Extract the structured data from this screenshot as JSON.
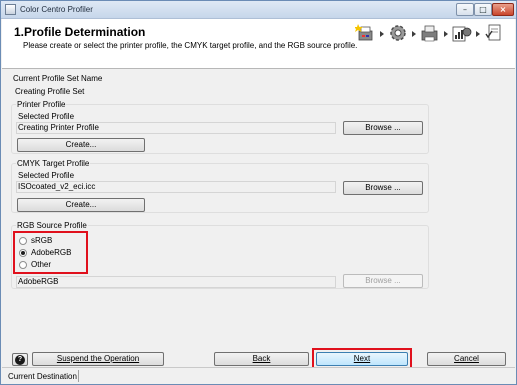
{
  "window": {
    "title": "Color Centro Profiler"
  },
  "header": {
    "title": "1.Profile Determination",
    "subtitle": "Please create or select the printer profile, the CMYK target profile, and the RGB source profile.",
    "steps": [
      "printer-wand-icon",
      "gear-icon",
      "printer-plus-icon",
      "chart-icon",
      "document-check-icon"
    ]
  },
  "profile_set": {
    "heading": "Current Profile Set Name",
    "value": "Creating Profile Set"
  },
  "printer_profile": {
    "group_title": "Printer Profile",
    "selected_label": "Selected Profile",
    "selected_value": "Creating Printer Profile",
    "browse_label": "Browse ...",
    "create_label": "Create..."
  },
  "cmyk_profile": {
    "group_title": "CMYK Target Profile",
    "selected_label": "Selected Profile",
    "selected_value": "ISOcoated_v2_eci.icc",
    "browse_label": "Browse ...",
    "create_label": "Create..."
  },
  "rgb_profile": {
    "group_title": "RGB Source Profile",
    "options": [
      {
        "label": "sRGB",
        "checked": false
      },
      {
        "label": "AdobeRGB",
        "checked": true
      },
      {
        "label": "Other",
        "checked": false
      }
    ],
    "selected_value": "AdobeRGB",
    "browse_label": "Browse ...",
    "browse_enabled": false
  },
  "footer": {
    "help_label": "?",
    "suspend_label": "Suspend the Operation",
    "back_label": "Back",
    "next_label": "Next",
    "cancel_label": "Cancel"
  },
  "status": {
    "text": "Current Destination"
  },
  "colors": {
    "highlight": "#e0101c",
    "title_bar": "#c6d6ea"
  }
}
